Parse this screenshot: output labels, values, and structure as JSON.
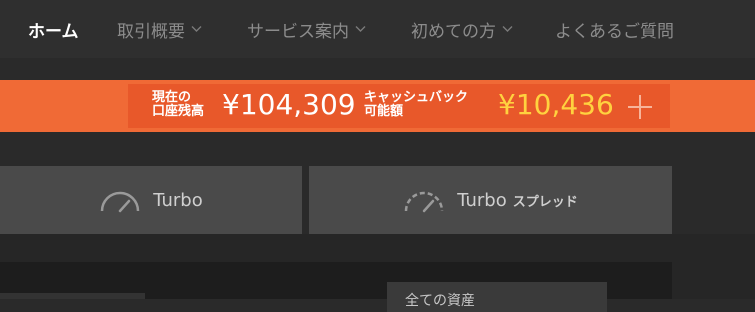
{
  "nav": {
    "items": [
      {
        "label": "ホーム",
        "dropdown": false,
        "active": true
      },
      {
        "label": "取引概要",
        "dropdown": true,
        "active": false
      },
      {
        "label": "サービス案内",
        "dropdown": true,
        "active": false
      },
      {
        "label": "初めての方",
        "dropdown": true,
        "active": false
      },
      {
        "label": "よくあるご質問",
        "dropdown": false,
        "active": false
      }
    ]
  },
  "balance": {
    "label_line1": "現在の",
    "label_line2": "口座残高",
    "amount": "¥104,309",
    "cashback_label_line1": "キャッシュバック",
    "cashback_label_line2": "可能額",
    "cashback_amount": "¥10,436",
    "plus_icon": "plus-icon"
  },
  "tabs": [
    {
      "label": "Turbo",
      "suffix": "",
      "icon": "gauge-icon"
    },
    {
      "label": "Turbo",
      "suffix": "スプレッド",
      "icon": "gauge-dashed-icon"
    }
  ],
  "assets": {
    "selector_label": "全ての資産"
  },
  "colors": {
    "accent": "#f06a36",
    "cashback": "#ffd23f",
    "nav_bg": "#2f2f2f",
    "tab_bg": "#4a4a4a"
  }
}
